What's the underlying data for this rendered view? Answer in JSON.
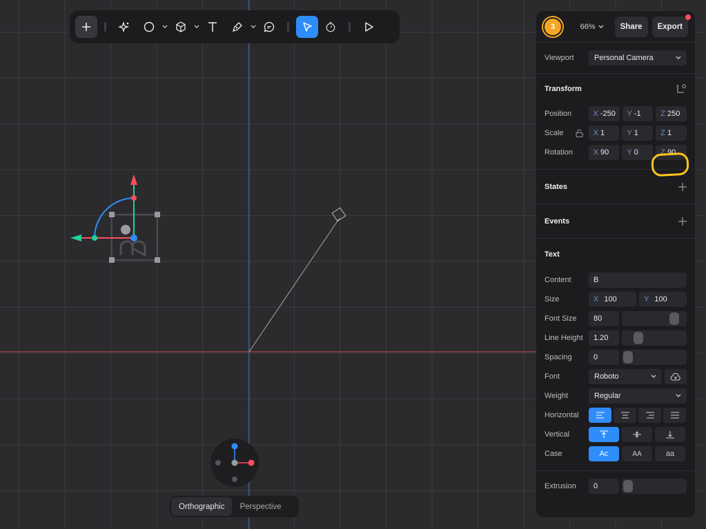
{
  "toolbar": {
    "tools": [
      "add",
      "ai-sparkle",
      "shape",
      "cube",
      "text",
      "pen",
      "comment",
      "select",
      "timer",
      "play"
    ],
    "active_tool": "select"
  },
  "header": {
    "avatar_label": "3",
    "zoom": "66%",
    "share_label": "Share",
    "export_label": "Export"
  },
  "viewport": {
    "label": "Viewport",
    "value": "Personal Camera"
  },
  "transform": {
    "title": "Transform",
    "position": {
      "label": "Position",
      "x": "-250",
      "y": "-1",
      "z": "250"
    },
    "scale": {
      "label": "Scale",
      "x": "1",
      "y": "1",
      "z": "1"
    },
    "rotation": {
      "label": "Rotation",
      "x": "90",
      "y": "0",
      "z": "90"
    }
  },
  "states": {
    "title": "States"
  },
  "events": {
    "title": "Events"
  },
  "text": {
    "title": "Text",
    "content": {
      "label": "Content",
      "value": "B"
    },
    "size": {
      "label": "Size",
      "x": "100",
      "y": "100"
    },
    "font_size": {
      "label": "Font Size",
      "value": "80",
      "slider": 0.88
    },
    "line_height": {
      "label": "Line Height",
      "value": "1.20",
      "slider": 0.2
    },
    "spacing": {
      "label": "Spacing",
      "value": "0",
      "slider": 0.0
    },
    "font": {
      "label": "Font",
      "value": "Roboto"
    },
    "weight": {
      "label": "Weight",
      "value": "Regular"
    },
    "horizontal": {
      "label": "Horizontal",
      "selected": 0
    },
    "vertical": {
      "label": "Vertical",
      "selected": 0
    },
    "case": {
      "label": "Case",
      "options": [
        "Ac",
        "AA",
        "aa"
      ],
      "selected": 0
    }
  },
  "extrusion": {
    "label": "Extrusion",
    "value": "0",
    "slider": 0.0
  },
  "projection": {
    "options": [
      "Orthographic",
      "Perspective"
    ],
    "selected": "Orthographic"
  },
  "axis_labels": {
    "x": "X",
    "y": "Y",
    "z": "Z"
  },
  "colors": {
    "accent": "#2f8dfb",
    "x_axis": "#ff4d5e",
    "y_axis": "#1ed49a",
    "z_axis": "#2f8dfb",
    "highlight": "#ffc61a"
  }
}
